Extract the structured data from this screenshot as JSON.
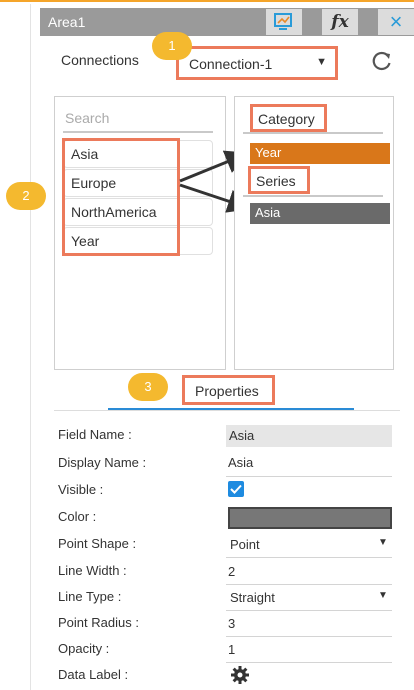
{
  "header": {
    "title": "Area1",
    "fx_label": "fx",
    "close_glyph": "×",
    "icons": [
      "monitor-icon",
      "fx-icon",
      "close-icon"
    ]
  },
  "connection": {
    "label": "Connections",
    "selected": "Connection-1",
    "caret": "▼",
    "refresh_icon": "refresh-icon"
  },
  "badges": [
    "1",
    "2",
    "3"
  ],
  "fields": {
    "search_placeholder": "Search",
    "items": [
      "Asia",
      "Europe",
      "NorthAmerica",
      "Year"
    ]
  },
  "assignment": {
    "category_label": "Category",
    "category_value": "Year",
    "series_label": "Series",
    "series_value": "Asia"
  },
  "properties": {
    "tab_label": "Properties",
    "rows": [
      {
        "label": "Field Name :",
        "value": "Asia"
      },
      {
        "label": "Display Name :",
        "value": "Asia"
      },
      {
        "label": "Visible :",
        "value": ""
      },
      {
        "label": "Color :",
        "value": ""
      },
      {
        "label": "Point Shape :",
        "value": "Point"
      },
      {
        "label": "Line Width :",
        "value": "2"
      },
      {
        "label": "Line Type :",
        "value": "Straight"
      },
      {
        "label": "Point Radius :",
        "value": "3"
      },
      {
        "label": "Opacity :",
        "value": "1"
      },
      {
        "label": "Data Label :",
        "value": ""
      }
    ],
    "visible_checked": true,
    "color_hex": "#777777",
    "select_caret": "▼",
    "data_label_icon": "gear-icon"
  },
  "colors": {
    "highlight": "#ec7a5b",
    "badge": "#f4b92f",
    "category_bar": "#d9771a",
    "series_bar": "#6a6a6a",
    "accent": "#2a8bd6"
  }
}
